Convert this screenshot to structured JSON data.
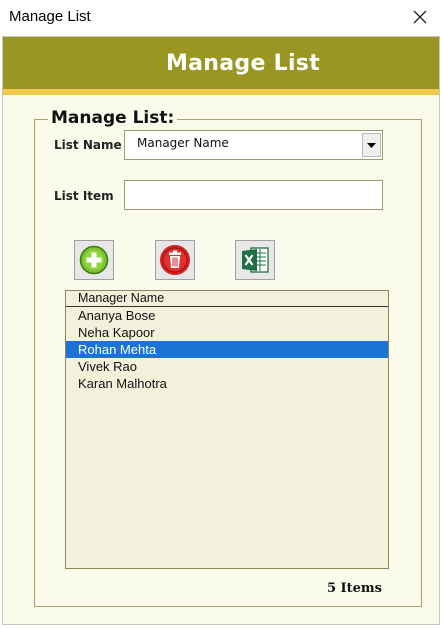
{
  "window": {
    "title": "Manage List"
  },
  "banner": {
    "title": "Manage List"
  },
  "group": {
    "legend": "Manage List:"
  },
  "form": {
    "list_name_label": "List Name",
    "list_name_value": "Manager Name",
    "list_item_label": "List Item",
    "list_item_value": ""
  },
  "toolbar": {
    "add_icon": "add-circle-icon",
    "delete_icon": "trash-icon",
    "export_icon": "excel-icon"
  },
  "list": {
    "header": "Manager Name",
    "items": [
      "Ananya Bose",
      "Neha Kapoor",
      "Rohan Mehta",
      "Vivek Rao",
      "Karan Malhotra"
    ],
    "selected": "Rohan Mehta"
  },
  "footer": {
    "count": "5 Items"
  },
  "colors": {
    "banner": "#9a9624",
    "stripe": "#f2c94c",
    "background": "#fbfbec",
    "selection": "#1b74d1"
  }
}
